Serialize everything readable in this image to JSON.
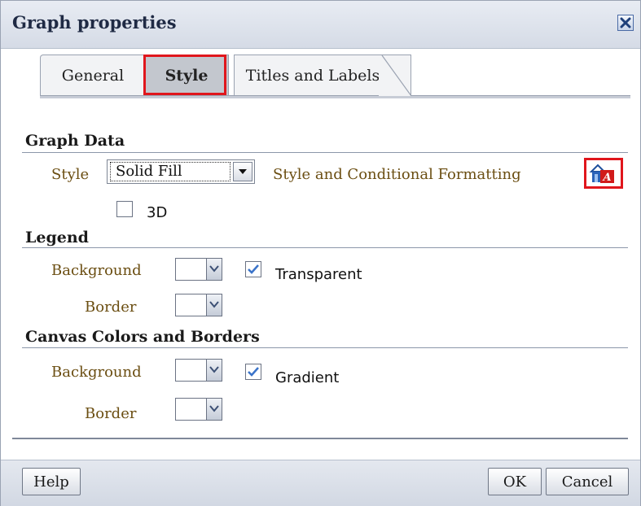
{
  "dialog": {
    "title": "Graph properties",
    "close_icon": "close-icon"
  },
  "tabs": [
    {
      "label": "General",
      "selected": false
    },
    {
      "label": "Style",
      "selected": true
    },
    {
      "label": "Titles and Labels",
      "selected": false
    }
  ],
  "graph_data": {
    "heading": "Graph Data",
    "style_label": "Style",
    "style_value": "Solid Fill",
    "conditional_label": "Style and Conditional Formatting",
    "conditional_icon": "conditional-formatting-icon",
    "three_d_label": "3D",
    "three_d_checked": false
  },
  "legend": {
    "heading": "Legend",
    "background_label": "Background",
    "transparent_label": "Transparent",
    "transparent_checked": true,
    "border_label": "Border"
  },
  "canvas": {
    "heading": "Canvas Colors and Borders",
    "background_label": "Background",
    "gradient_label": "Gradient",
    "gradient_checked": true,
    "border_label": "Border"
  },
  "footer": {
    "help_label": "Help",
    "ok_label": "OK",
    "cancel_label": "Cancel"
  },
  "colors": {
    "highlight": "#e0161c",
    "label_text": "#6b4e12",
    "check_mark": "#3a73c9"
  }
}
